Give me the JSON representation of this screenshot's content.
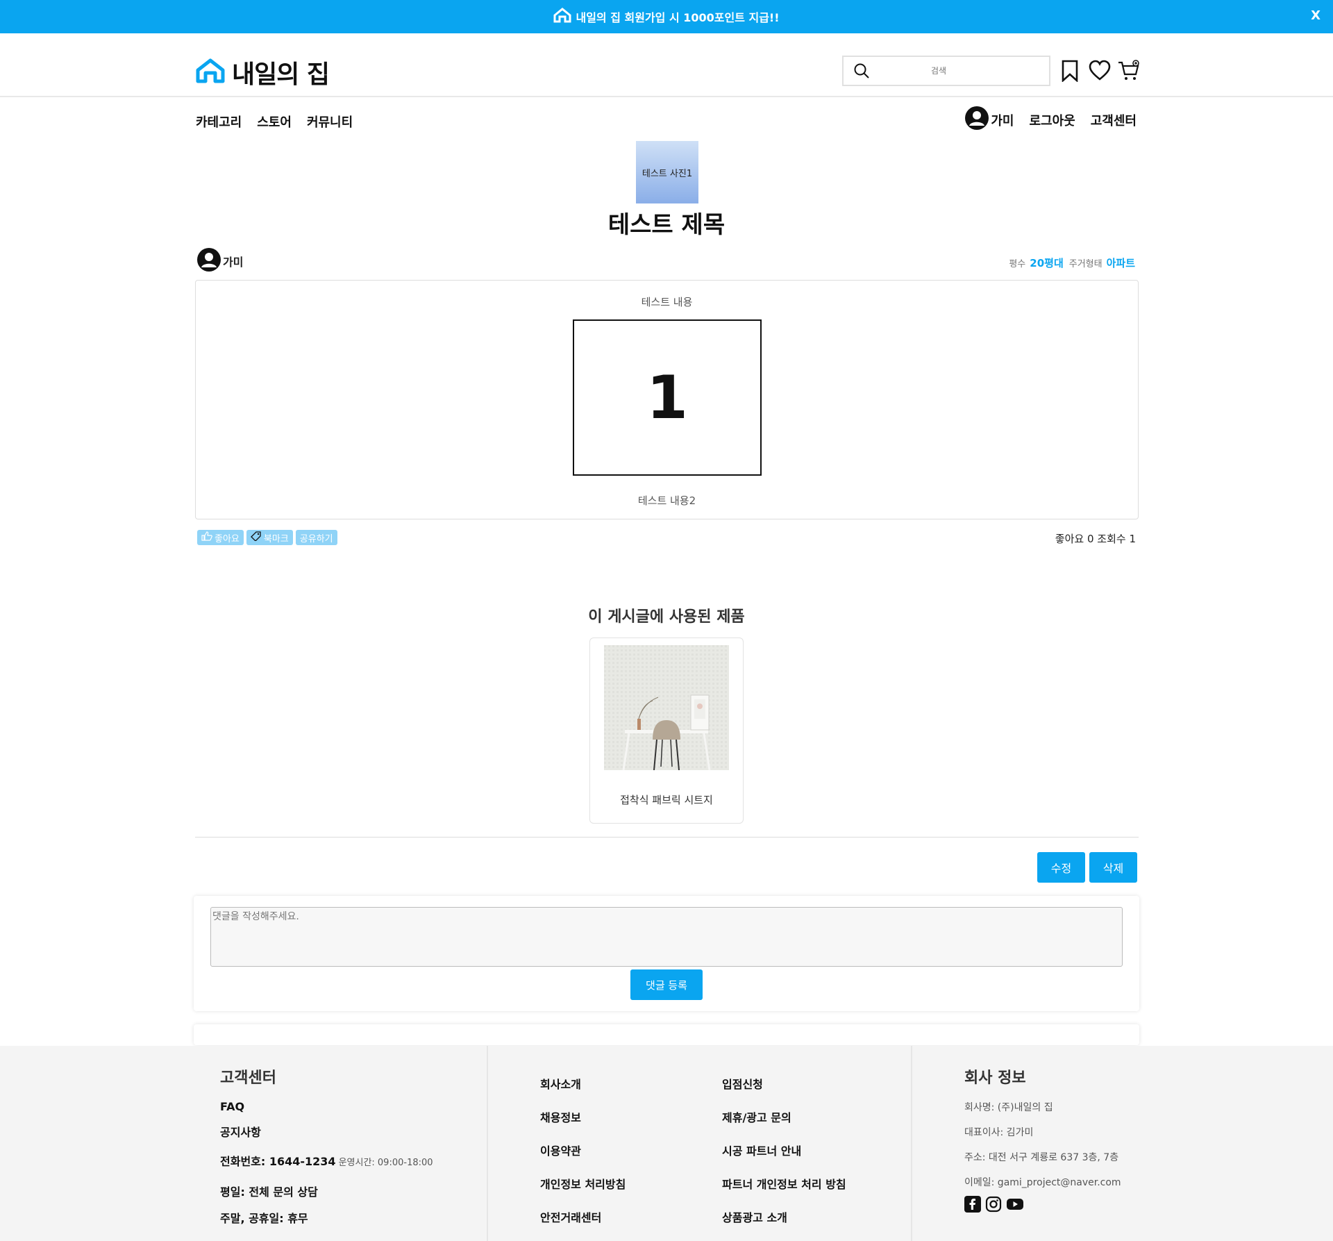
{
  "banner": {
    "text": "내일의 집 회원가입 시 1000포인트 지급!!",
    "close": "X"
  },
  "header": {
    "logo_text": "내일의 집",
    "search_placeholder": "검색",
    "icons": [
      "bookmark-icon",
      "heart-icon",
      "cart-icon"
    ]
  },
  "nav": {
    "left": [
      "카테고리",
      "스토어",
      "커뮤니티"
    ],
    "user_name": "가미",
    "logout": "로그아웃",
    "support": "고객센터"
  },
  "post": {
    "cover_label": "테스트 사진1",
    "title": "테스트 제목",
    "author": "가미",
    "area_label": "평수",
    "area_value": "20평대",
    "housing_label": "주거형태",
    "housing_value": "아파트",
    "content_text1": "테스트 내용",
    "content_image_text": "1",
    "content_text2": "테스트 내용2",
    "actions": {
      "like": "좋아요",
      "bookmark": "북마크",
      "share": "공유하기"
    },
    "stats": "좋아요 0 조회수 1"
  },
  "products": {
    "title": "이 게시글에 사용된 제품",
    "items": [
      {
        "name": "접착식 패브릭 시트지"
      }
    ]
  },
  "post_buttons": {
    "edit": "수정",
    "delete": "삭제"
  },
  "comment": {
    "placeholder": "댓글을 작성해주세요.",
    "submit": "댓글 등록"
  },
  "footer": {
    "support_title": "고객센터",
    "faq": "FAQ",
    "notice": "공지사항",
    "phone_label": "전화번호: 1644-1234",
    "hours": "운영시간: 09:00-18:00",
    "weekday": "평일: 전체 문의 상담",
    "weekend": "주말, 공휴일: 휴무",
    "links": [
      "회사소개",
      "입점신청",
      "채용정보",
      "제휴/광고 문의",
      "이용약관",
      "시공 파트너 안내",
      "개인정보 처리방침",
      "파트너 개인정보 처리 방침",
      "안전거래센터",
      "상품광고 소개"
    ],
    "company_title": "회사 정보",
    "company_name": "회사명: (주)내일의 집",
    "ceo": "대표이사: 김가미",
    "address": "주소: 대전 서구 계룡로 637 3층, 7층",
    "email": "이메일: gami_project@naver.com",
    "social": [
      "facebook-icon",
      "instagram-icon",
      "youtube-icon"
    ]
  },
  "colors": {
    "accent": "#0aa5f0",
    "chip": "#8fd3f7",
    "footer_bg": "#f4f4f4"
  }
}
